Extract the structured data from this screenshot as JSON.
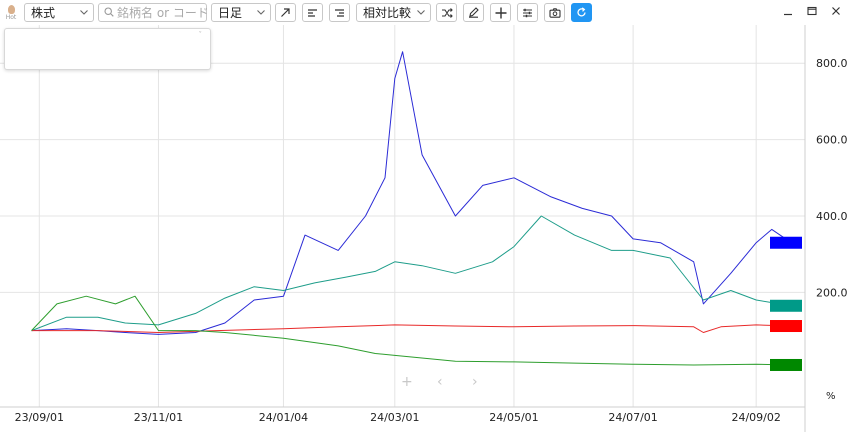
{
  "toolbar": {
    "hot_label": "Hot",
    "market_select": "株式",
    "search_placeholder": "銘柄名 or コード",
    "period_select": "日足",
    "mode_select": "相対比較"
  },
  "icons": [
    "hot-flame-icon",
    "chevron-down-icon",
    "search-icon",
    "trend-arrow-icon",
    "align-left-icon",
    "align-right-icon",
    "shuffle-icon",
    "pencil-icon",
    "crosshair-icon",
    "sliders-icon",
    "camera-icon",
    "refresh-icon",
    "minimize-icon",
    "maximize-icon",
    "close-icon"
  ],
  "colors": {
    "accent": "#2196f3",
    "blue": "#2b2bd6",
    "teal": "#1e9d8a",
    "red": "#e82a2a",
    "green": "#2e9e2e"
  },
  "chart_data": {
    "type": "line",
    "unit": "%",
    "y_ticks": [
      "200.0",
      "400.0",
      "600.0",
      "800.0"
    ],
    "x_ticks": [
      "23/09/01",
      "23/11/01",
      "24/01/04",
      "24/03/01",
      "24/05/01",
      "24/07/01",
      "24/09/02"
    ],
    "ylim": [
      -100,
      900
    ],
    "grid": true,
    "series": [
      {
        "color": "#2b2bd6",
        "legend_color": "#0000ff",
        "x": [
          "23/08/28",
          "23/09/15",
          "23/10/01",
          "23/10/15",
          "23/11/01",
          "23/11/20",
          "23/12/05",
          "23/12/20",
          "24/01/04",
          "24/01/15",
          "24/02/01",
          "24/02/15",
          "24/02/25",
          "24/03/01",
          "24/03/05",
          "24/03/15",
          "24/04/01",
          "24/04/15",
          "24/05/01",
          "24/05/20",
          "24/06/05",
          "24/06/20",
          "24/07/01",
          "24/07/15",
          "24/08/01",
          "24/08/06",
          "24/08/20",
          "24/09/02",
          "24/09/10",
          "24/09/20"
        ],
        "values": [
          100,
          105,
          100,
          95,
          90,
          95,
          120,
          180,
          190,
          350,
          310,
          400,
          500,
          760,
          830,
          560,
          400,
          480,
          500,
          450,
          420,
          400,
          340,
          330,
          280,
          170,
          250,
          330,
          365,
          330
        ]
      },
      {
        "color": "#1e9d8a",
        "legend_color": "#009a88",
        "x": [
          "23/08/28",
          "23/09/15",
          "23/10/01",
          "23/10/15",
          "23/11/01",
          "23/11/20",
          "23/12/05",
          "23/12/20",
          "24/01/04",
          "24/01/20",
          "24/02/05",
          "24/02/20",
          "24/03/01",
          "24/03/15",
          "24/04/01",
          "24/04/20",
          "24/05/01",
          "24/05/15",
          "24/06/01",
          "24/06/20",
          "24/07/01",
          "24/07/20",
          "24/08/06",
          "24/08/20",
          "24/09/02",
          "24/09/20"
        ],
        "values": [
          100,
          135,
          135,
          120,
          115,
          145,
          185,
          215,
          205,
          225,
          240,
          255,
          280,
          270,
          250,
          280,
          320,
          400,
          350,
          310,
          310,
          290,
          180,
          205,
          180,
          165
        ]
      },
      {
        "color": "#e82a2a",
        "legend_color": "#ff0000",
        "x": [
          "23/08/28",
          "23/10/01",
          "23/11/01",
          "23/12/01",
          "24/01/04",
          "24/02/01",
          "24/03/01",
          "24/04/01",
          "24/05/01",
          "24/06/01",
          "24/07/01",
          "24/08/01",
          "24/08/06",
          "24/08/15",
          "24/09/02",
          "24/09/20"
        ],
        "values": [
          100,
          100,
          95,
          100,
          105,
          110,
          115,
          112,
          110,
          112,
          113,
          110,
          95,
          110,
          115,
          112
        ]
      },
      {
        "color": "#2e9e2e",
        "legend_color": "#008800",
        "x": [
          "23/08/28",
          "23/09/10",
          "23/09/25",
          "23/10/10",
          "23/10/20",
          "23/11/01",
          "23/11/20",
          "23/12/05",
          "24/01/04",
          "24/02/01",
          "24/02/20",
          "24/03/01",
          "24/04/01",
          "24/05/01",
          "24/06/01",
          "24/07/01",
          "24/08/01",
          "24/09/02",
          "24/09/20"
        ],
        "values": [
          100,
          170,
          190,
          170,
          190,
          100,
          100,
          95,
          80,
          60,
          40,
          35,
          20,
          18,
          15,
          12,
          10,
          12,
          10
        ]
      }
    ]
  }
}
